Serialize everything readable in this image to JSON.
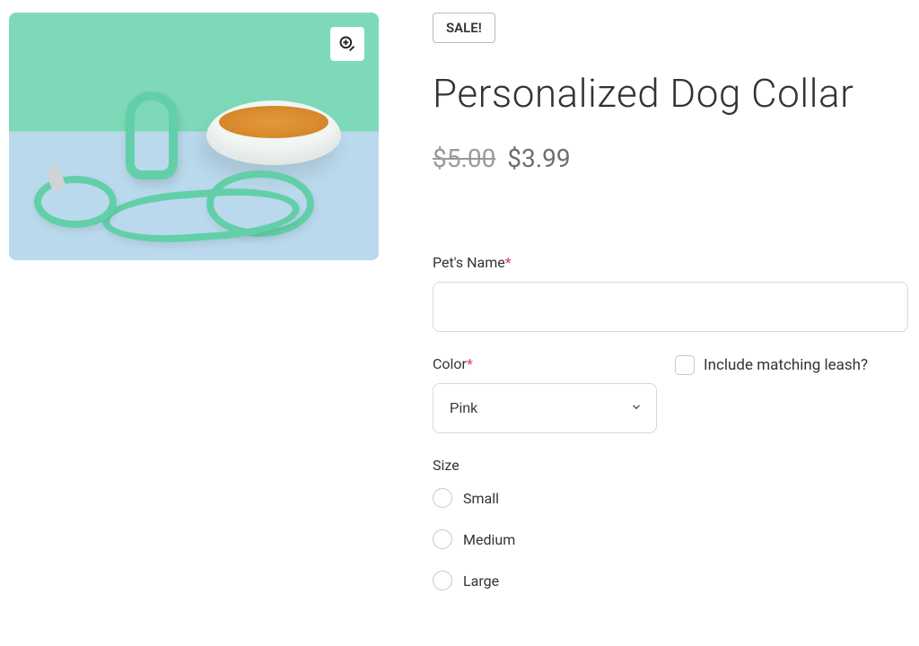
{
  "product": {
    "sale_badge": "SALE!",
    "title": "Personalized Dog Collar",
    "price_old": "$5.00",
    "price_new": "$3.99"
  },
  "form": {
    "pet_name": {
      "label": "Pet's Name",
      "required_mark": "*",
      "value": ""
    },
    "color": {
      "label": "Color",
      "required_mark": "*",
      "selected": "Pink"
    },
    "leash": {
      "label": "Include matching leash?"
    },
    "size": {
      "label": "Size",
      "options": [
        "Small",
        "Medium",
        "Large"
      ]
    }
  }
}
